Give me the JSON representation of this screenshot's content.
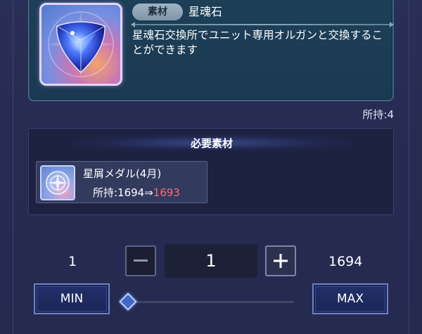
{
  "item": {
    "type_badge": "素材",
    "name": "星魂石",
    "description": "星魂石交換所でユニット専用オルガンと交換することができます",
    "icon": "star-soul-stone-crystal-icon"
  },
  "owned_label": "所持:4",
  "required_materials": {
    "title": "必要素材",
    "items": [
      {
        "name": "星屑メダル(4月)",
        "owned_prefix": "所持:1694⇒",
        "owned_after": "1693",
        "icon": "stardust-medal-icon"
      }
    ]
  },
  "quantity": {
    "min_value": "1",
    "max_value": "1694",
    "current": "1",
    "slider_fraction": 0.0,
    "minus_icon": "minus-icon",
    "plus_icon": "plus-icon",
    "min_label": "MIN",
    "max_label": "MAX"
  },
  "colors": {
    "background": "#272b52",
    "info_panel": "#1a3a52",
    "decrease_highlight": "#ff6b73",
    "button_border": "#6f81c4"
  }
}
